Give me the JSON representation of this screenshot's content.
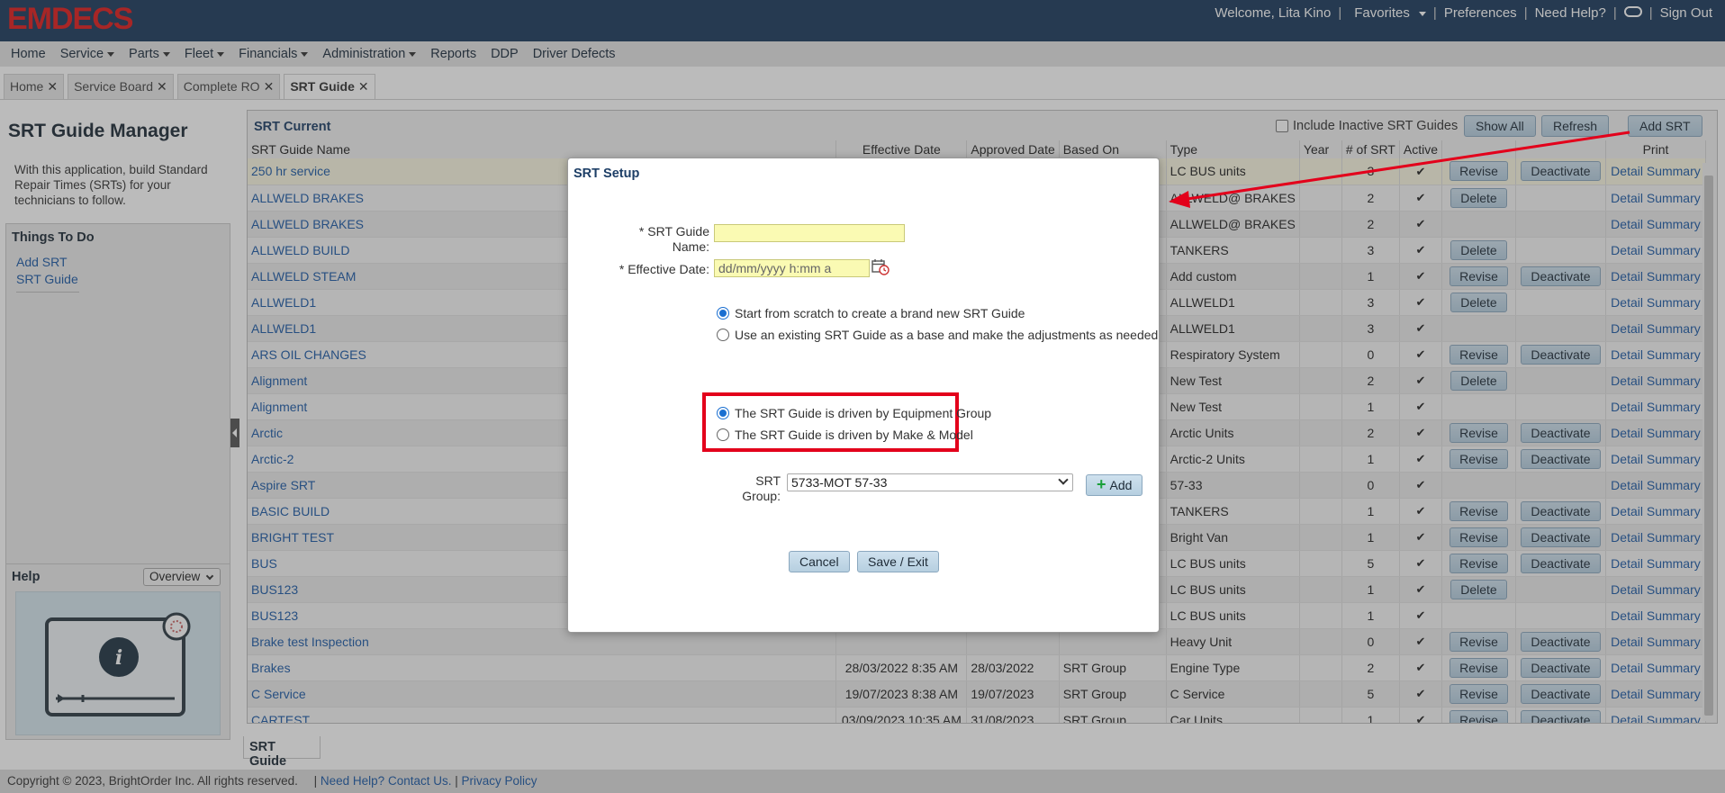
{
  "header": {
    "logo": "EMDECS",
    "welcome": "Welcome, Lita Kino",
    "favorites": "Favorites",
    "preferences": "Preferences",
    "need_help": "Need Help?",
    "sign_out": "Sign Out"
  },
  "menu": {
    "items": [
      "Home",
      "Service",
      "Parts",
      "Fleet",
      "Financials",
      "Administration",
      "Reports",
      "DDP",
      "Driver Defects"
    ]
  },
  "tabs": [
    "Home",
    "Service Board",
    "Complete RO",
    "SRT Guide"
  ],
  "left": {
    "title": "SRT Guide Manager",
    "intro": "With this application, build Standard Repair Times (SRTs) for your technicians to follow.",
    "todo_title": "Things To Do",
    "todo_links": [
      "Add SRT",
      "SRT Guide"
    ],
    "help_title": "Help",
    "help_select": "Overview"
  },
  "main": {
    "title": "SRT Current",
    "include_inactive": "Include Inactive SRT Guides",
    "show_all": "Show All",
    "refresh": "Refresh",
    "add_srt": "Add SRT",
    "columns": [
      "SRT Guide Name",
      "Effective Date",
      "Approved Date",
      "Based On",
      "Type",
      "Year",
      "# of SRT",
      "Active",
      "",
      "",
      "Print"
    ],
    "rows": [
      {
        "name": "250 hr service",
        "eff": "",
        "appr": "",
        "based": "",
        "type": "LC BUS units",
        "count": "3",
        "b1": "Revise",
        "b2": "Deactivate"
      },
      {
        "name": "ALLWELD BRAKES",
        "eff": "",
        "appr": "",
        "based": "",
        "type": "ALLWELD@ BRAKES",
        "count": "2",
        "b1": "Delete",
        "b2": ""
      },
      {
        "name": "ALLWELD BRAKES",
        "eff": "",
        "appr": "",
        "based": "",
        "type": "ALLWELD@ BRAKES",
        "count": "2",
        "b1": "",
        "b2": ""
      },
      {
        "name": "ALLWELD BUILD",
        "eff": "",
        "appr": "",
        "based": "",
        "type": "TANKERS",
        "count": "3",
        "b1": "Delete",
        "b2": ""
      },
      {
        "name": "ALLWELD STEAM",
        "eff": "",
        "appr": "",
        "based": "",
        "type": "Add custom",
        "count": "1",
        "b1": "Revise",
        "b2": "Deactivate"
      },
      {
        "name": "ALLWELD1",
        "eff": "",
        "appr": "",
        "based": "",
        "type": "ALLWELD1",
        "count": "3",
        "b1": "Delete",
        "b2": ""
      },
      {
        "name": "ALLWELD1",
        "eff": "",
        "appr": "",
        "based": "",
        "type": "ALLWELD1",
        "count": "3",
        "b1": "",
        "b2": ""
      },
      {
        "name": "ARS OIL CHANGES",
        "eff": "",
        "appr": "",
        "based": "",
        "type": "Respiratory System",
        "count": "0",
        "b1": "Revise",
        "b2": "Deactivate"
      },
      {
        "name": "Alignment",
        "eff": "",
        "appr": "",
        "based": "",
        "type": "New Test",
        "count": "2",
        "b1": "Delete",
        "b2": ""
      },
      {
        "name": "Alignment",
        "eff": "",
        "appr": "",
        "based": "",
        "type": "New Test",
        "count": "1",
        "b1": "",
        "b2": ""
      },
      {
        "name": "Arctic",
        "eff": "",
        "appr": "",
        "based": "",
        "type": "Arctic Units",
        "count": "2",
        "b1": "Revise",
        "b2": "Deactivate"
      },
      {
        "name": "Arctic-2",
        "eff": "",
        "appr": "",
        "based": "",
        "type": "Arctic-2 Units",
        "count": "1",
        "b1": "Revise",
        "b2": "Deactivate"
      },
      {
        "name": "Aspire SRT",
        "eff": "",
        "appr": "",
        "based": "",
        "type": "57-33",
        "count": "0",
        "b1": "",
        "b2": ""
      },
      {
        "name": "BASIC BUILD",
        "eff": "",
        "appr": "",
        "based": "",
        "type": "TANKERS",
        "count": "1",
        "b1": "Revise",
        "b2": "Deactivate"
      },
      {
        "name": "BRIGHT TEST",
        "eff": "",
        "appr": "",
        "based": "",
        "type": "Bright Van",
        "count": "1",
        "b1": "Revise",
        "b2": "Deactivate"
      },
      {
        "name": "BUS",
        "eff": "",
        "appr": "",
        "based": "",
        "type": "LC BUS units",
        "count": "5",
        "b1": "Revise",
        "b2": "Deactivate"
      },
      {
        "name": "BUS123",
        "eff": "",
        "appr": "",
        "based": "",
        "type": "LC BUS units",
        "count": "1",
        "b1": "Delete",
        "b2": ""
      },
      {
        "name": "BUS123",
        "eff": "",
        "appr": "",
        "based": "",
        "type": "LC BUS units",
        "count": "1",
        "b1": "",
        "b2": ""
      },
      {
        "name": "Brake test Inspection",
        "eff": "",
        "appr": "",
        "based": "",
        "type": "Heavy Unit",
        "count": "0",
        "b1": "Revise",
        "b2": "Deactivate"
      },
      {
        "name": "Brakes",
        "eff": "28/03/2022 8:35 AM",
        "appr": "28/03/2022",
        "based": "SRT Group",
        "type": "Engine Type",
        "count": "2",
        "b1": "Revise",
        "b2": "Deactivate"
      },
      {
        "name": "C Service",
        "eff": "19/07/2023 8:38 AM",
        "appr": "19/07/2023",
        "based": "SRT Group",
        "type": "C Service",
        "count": "5",
        "b1": "Revise",
        "b2": "Deactivate"
      },
      {
        "name": "CARTEST",
        "eff": "03/09/2023 10:35 AM",
        "appr": "31/08/2023",
        "based": "SRT Group",
        "type": "Car Units",
        "count": "1",
        "b1": "Revise",
        "b2": "Deactivate"
      }
    ],
    "print_detail": "Detail",
    "print_summary": "Summary"
  },
  "bottom_tab": "SRT Guide",
  "footer": {
    "copyright": "Copyright © 2023, BrightOrder Inc. All rights reserved.",
    "need_help": "Need Help? Contact Us.",
    "privacy": "Privacy Policy"
  },
  "modal": {
    "title": "SRT Setup",
    "name_label_1": "* SRT Guide",
    "name_label_2": "Name:",
    "name_value": "",
    "eff_label": "* Effective Date:",
    "eff_placeholder": "dd/mm/yyyy h:mm a",
    "option_scratch": "Start from scratch to create a brand new SRT Guide",
    "option_existing": "Use an existing SRT Guide as a base and make the adjustments as needed",
    "option_equipment": "The SRT Guide is driven by Equipment Group",
    "option_make_model": "The SRT Guide is driven by Make & Model",
    "group_label_1": "SRT",
    "group_label_2": "Group:",
    "group_value": "5733-MOT 57-33",
    "add": "Add",
    "cancel": "Cancel",
    "save_exit": "Save / Exit"
  }
}
